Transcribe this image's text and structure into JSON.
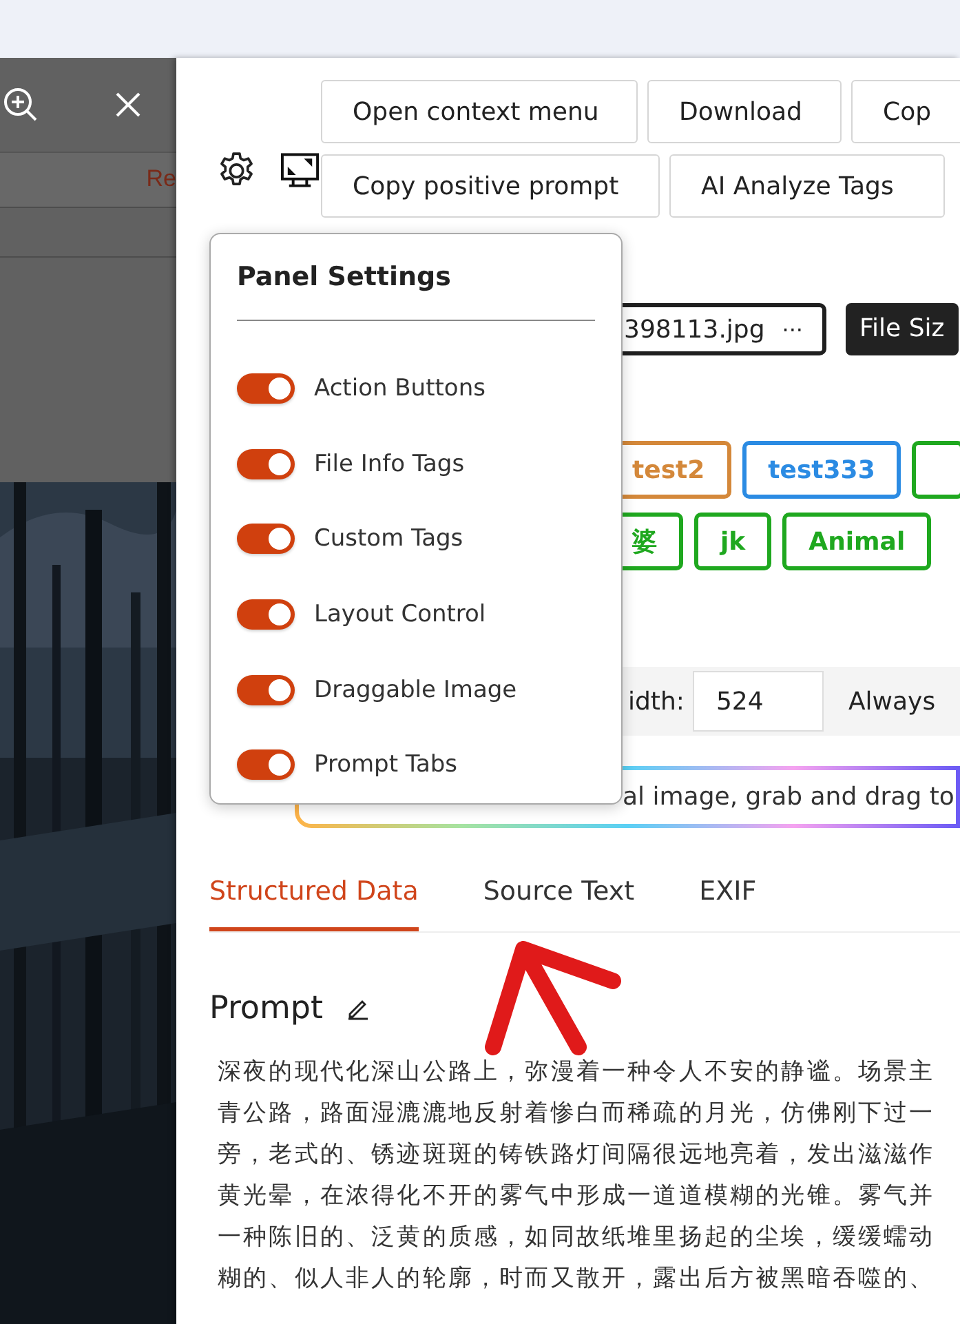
{
  "viewer_toolbar": {
    "ref_text": "Re"
  },
  "action_buttons": [
    {
      "label": "Open context menu"
    },
    {
      "label": "Download"
    },
    {
      "label": "Cop"
    },
    {
      "label": "Copy positive prompt"
    },
    {
      "label": "AI Analyze Tags"
    }
  ],
  "file_info": {
    "file_name": "398113.jpg",
    "more": "···",
    "file_size_label": "File Siz"
  },
  "custom_tags": [
    {
      "label": "test2",
      "color": "#d4883a"
    },
    {
      "label": "test333",
      "color": "#2b8be3"
    },
    {
      "color": "#1fa81f"
    },
    {
      "label": "婆",
      "color": "#1fa81f"
    },
    {
      "label": "jk",
      "color": "#1fa81f"
    },
    {
      "label": "Animal",
      "color": "#1fa81f"
    }
  ],
  "layout_control": {
    "width_label": "idth:",
    "width_value": "524",
    "always_label": "Always"
  },
  "drag_hint": "al image, grab and drag to",
  "tabs": [
    {
      "label": "Structured Data",
      "selected": true
    },
    {
      "label": "Source Text",
      "selected": false
    },
    {
      "label": "EXIF",
      "selected": false
    }
  ],
  "prompt": {
    "title": "Prompt",
    "lines": [
      "深夜的现代化深山公路上，弥漫着一种令人不安的静谧。场景主",
      "青公路，路面湿漉漉地反射着惨白而稀疏的月光，仿佛刚下过一",
      "旁，老式的、锈迹斑斑的铸铁路灯间隔很远地亮着，发出滋滋作",
      "黄光晕，在浓得化不开的雾气中形成一道道模糊的光锥。雾气并",
      "一种陈旧的、泛黄的质感，如同故纸堆里扬起的尘埃，缓缓蠕动",
      "糊的、似人非人的轮廓，时而又散开，露出后方被黑暗吞噬的、"
    ]
  },
  "panel_settings": {
    "title": "Panel Settings",
    "options": [
      {
        "label": "Action Buttons",
        "on": true
      },
      {
        "label": "File Info Tags",
        "on": true
      },
      {
        "label": "Custom Tags",
        "on": true
      },
      {
        "label": "Layout Control",
        "on": true
      },
      {
        "label": "Draggable Image",
        "on": true
      },
      {
        "label": "Prompt Tabs",
        "on": true
      }
    ]
  }
}
